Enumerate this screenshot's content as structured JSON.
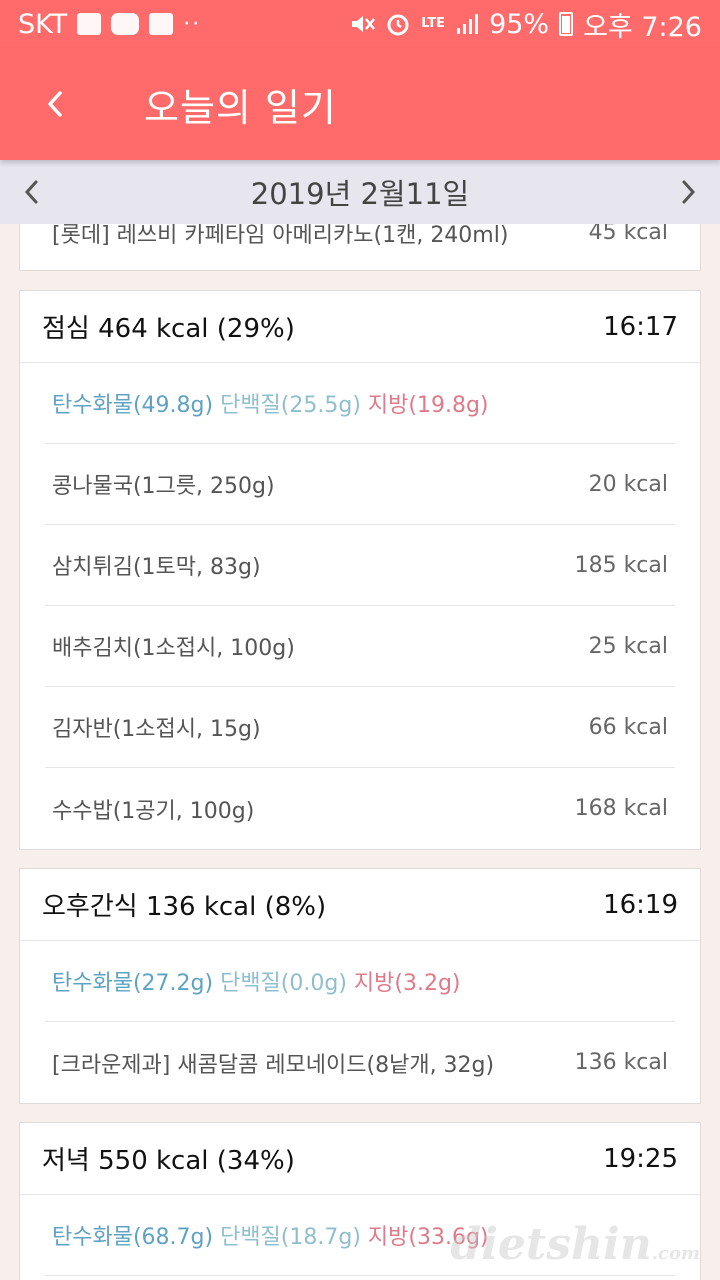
{
  "status_bar": {
    "carrier": "SKT",
    "notif_dots": "··",
    "battery": "95%",
    "time": "오후 7:26",
    "lte_label": "LTE",
    "icons": [
      "gallery-icon",
      "youtube-icon",
      "document-icon",
      "mute-icon",
      "alarm-icon",
      "lte-icon",
      "signal-icon",
      "battery-icon"
    ]
  },
  "app_bar": {
    "title": "오늘의 일기",
    "back_icon": "chevron-left-icon"
  },
  "date_bar": {
    "date": "2019년 2월11일",
    "prev_icon": "chevron-left-icon",
    "next_icon": "chevron-right-icon"
  },
  "colors": {
    "accent": "#ff6b6b",
    "carb": "#5fa3c4",
    "protein": "#8fbfcf",
    "fat": "#e07a8a",
    "date_bar_bg": "#e7e6ef",
    "page_bg": "#f6efeb"
  },
  "partial_top_item": {
    "name": "[롯데] 레쓰비 카페타임 아메리카노(1캔, 240ml)",
    "kcal": "45 kcal"
  },
  "meals": [
    {
      "header": "점심 464 kcal (29%)",
      "time": "16:17",
      "carb": "탄수화물(49.8g)",
      "protein": "단백질(25.5g)",
      "fat": "지방(19.8g)",
      "items": [
        {
          "name": "콩나물국(1그릇, 250g)",
          "kcal": "20 kcal"
        },
        {
          "name": "삼치튀김(1토막, 83g)",
          "kcal": "185 kcal"
        },
        {
          "name": "배추김치(1소접시, 100g)",
          "kcal": "25 kcal"
        },
        {
          "name": "김자반(1소접시, 15g)",
          "kcal": "66 kcal"
        },
        {
          "name": "수수밥(1공기, 100g)",
          "kcal": "168 kcal"
        }
      ]
    },
    {
      "header": "오후간식 136 kcal (8%)",
      "time": "16:19",
      "carb": "탄수화물(27.2g)",
      "protein": "단백질(0.0g)",
      "fat": "지방(3.2g)",
      "items": [
        {
          "name": "[크라운제과] 새콤달콤 레모네이드(8낱개, 32g)",
          "kcal": "136 kcal"
        }
      ]
    },
    {
      "header": "저녁 550 kcal (34%)",
      "time": "19:25",
      "carb": "탄수화물(68.7g)",
      "protein": "단백질(18.7g)",
      "fat": "지방(33.6g)",
      "items": []
    }
  ],
  "watermark": {
    "text": "dietshin",
    "suffix": ".com"
  }
}
